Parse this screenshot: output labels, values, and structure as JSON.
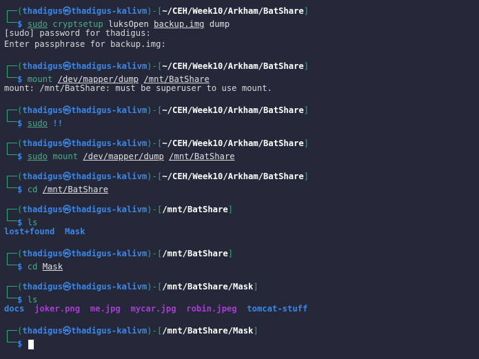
{
  "prompt": {
    "user": "thadigus",
    "separator": "㉿",
    "host": "thadigus-kalivm",
    "symbol": "$"
  },
  "blocks": [
    {
      "path": "~/CEH/Week10/Arkham/BatShare",
      "command": [
        {
          "text": "sudo",
          "style": "cmd u"
        },
        {
          "text": " cryptsetup",
          "style": "cmd"
        },
        {
          "text": " luksOpen ",
          "style": "arg"
        },
        {
          "text": "backup.img",
          "style": "arg u"
        },
        {
          "text": " dump",
          "style": "arg"
        }
      ],
      "output": [
        "[sudo] password for thadigus:",
        "Enter passphrase for backup.img:"
      ]
    },
    {
      "path": "~/CEH/Week10/Arkham/BatShare",
      "command": [
        {
          "text": "mount",
          "style": "cmd"
        },
        {
          "text": " ",
          "style": "arg"
        },
        {
          "text": "/dev/mapper/dump",
          "style": "arg u"
        },
        {
          "text": " ",
          "style": "arg"
        },
        {
          "text": "/mnt/BatShare",
          "style": "arg u"
        }
      ],
      "output": [
        "mount: /mnt/BatShare: must be superuser to use mount."
      ]
    },
    {
      "path": "~/CEH/Week10/Arkham/BatShare",
      "command": [
        {
          "text": "sudo",
          "style": "cmd u"
        },
        {
          "text": " ",
          "style": "arg"
        },
        {
          "text": "!!",
          "style": "bang"
        }
      ],
      "output": []
    },
    {
      "path": "~/CEH/Week10/Arkham/BatShare",
      "command": [
        {
          "text": "sudo",
          "style": "cmd u"
        },
        {
          "text": " mount ",
          "style": "cmd"
        },
        {
          "text": "/dev/mapper/dump",
          "style": "arg u"
        },
        {
          "text": " ",
          "style": "arg"
        },
        {
          "text": "/mnt/BatShare",
          "style": "arg u"
        }
      ],
      "output": []
    },
    {
      "path": "~/CEH/Week10/Arkham/BatShare",
      "command": [
        {
          "text": "cd",
          "style": "cmd"
        },
        {
          "text": " ",
          "style": "arg"
        },
        {
          "text": "/mnt/BatShare",
          "style": "arg u"
        }
      ],
      "output": []
    },
    {
      "path": "/mnt/BatShare",
      "command": [
        {
          "text": "ls",
          "style": "cmd"
        }
      ],
      "listing": [
        {
          "name": "lost+found",
          "type": "dir"
        },
        {
          "name": "Mask",
          "type": "dir"
        }
      ]
    },
    {
      "path": "/mnt/BatShare",
      "command": [
        {
          "text": "cd",
          "style": "cmd"
        },
        {
          "text": " ",
          "style": "arg"
        },
        {
          "text": "Mask",
          "style": "arg u"
        }
      ],
      "output": []
    },
    {
      "path": "/mnt/BatShare/Mask",
      "command": [
        {
          "text": "ls",
          "style": "cmd"
        }
      ],
      "listing": [
        {
          "name": "docs",
          "type": "dir"
        },
        {
          "name": "joker.png",
          "type": "img"
        },
        {
          "name": "me.jpg",
          "type": "img"
        },
        {
          "name": "mycar.jpg",
          "type": "img"
        },
        {
          "name": "robin.jpeg",
          "type": "img"
        },
        {
          "name": "tomcat-stuff",
          "type": "dir"
        }
      ]
    },
    {
      "path": "/mnt/BatShare/Mask",
      "command": [],
      "active": true
    }
  ],
  "colors": {
    "background": "#242838",
    "prompt_line": "#3aa57a",
    "user_host": "#3d86e6",
    "path": "#ffffff",
    "directory": "#3d86e6",
    "image_file": "#a93cd1"
  }
}
